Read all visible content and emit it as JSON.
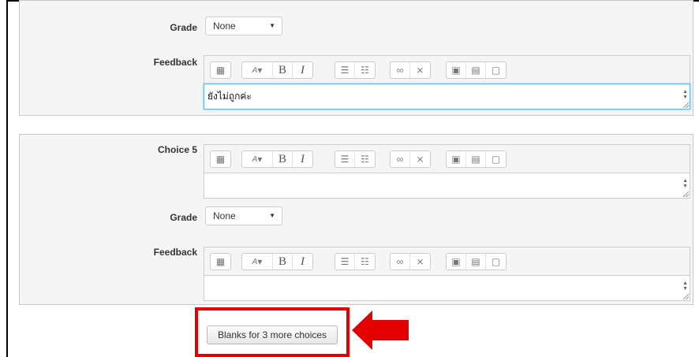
{
  "choice4": {
    "grade_label": "Grade",
    "grade_value": "None",
    "feedback_label": "Feedback",
    "feedback_text": "ยังไม่ถูกค่ะ"
  },
  "choice5": {
    "choice_label": "Choice 5",
    "choice_text": "",
    "grade_label": "Grade",
    "grade_value": "None",
    "feedback_label": "Feedback",
    "feedback_text": ""
  },
  "toolbar_icons": [
    "show-more-buttons-icon",
    "font-color-icon",
    "bold-icon",
    "italic-icon",
    "unordered-list-icon",
    "ordered-list-icon",
    "link-icon",
    "unlink-icon",
    "image-icon",
    "media-icon",
    "manage-files-icon"
  ],
  "blanks_button_label": "Blanks for 3 more choices",
  "annotation_color": "#e40000"
}
